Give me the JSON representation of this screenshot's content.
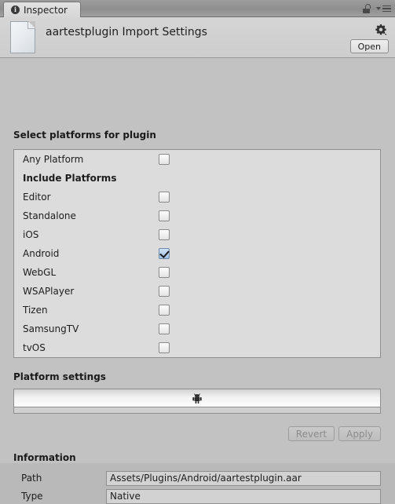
{
  "window": {
    "tab_label": "Inspector",
    "tab_icon": "info-circle-icon",
    "lock_icon": "lock-open-icon",
    "menu_icon": "hamburger-menu-icon"
  },
  "header": {
    "title": "aartestplugin Import Settings",
    "file_icon": "document-icon",
    "gear_icon": "gear-icon",
    "open_label": "Open"
  },
  "platforms": {
    "section_title": "Select platforms for plugin",
    "any_platform": {
      "label": "Any Platform",
      "checked": false
    },
    "include_title": "Include Platforms",
    "items": [
      {
        "label": "Editor",
        "checked": false
      },
      {
        "label": "Standalone",
        "checked": false
      },
      {
        "label": "iOS",
        "checked": false
      },
      {
        "label": "Android",
        "checked": true
      },
      {
        "label": "WebGL",
        "checked": false
      },
      {
        "label": "WSAPlayer",
        "checked": false
      },
      {
        "label": "Tizen",
        "checked": false
      },
      {
        "label": "SamsungTV",
        "checked": false
      },
      {
        "label": "tvOS",
        "checked": false
      }
    ]
  },
  "platform_settings": {
    "section_title": "Platform settings",
    "active_tab_icon": "android-icon"
  },
  "actions": {
    "revert_label": "Revert",
    "apply_label": "Apply",
    "revert_enabled": false,
    "apply_enabled": false
  },
  "information": {
    "section_title": "Information",
    "rows": [
      {
        "label": "Path",
        "value": "Assets/Plugins/Android/aartestplugin.aar"
      },
      {
        "label": "Type",
        "value": "Native"
      }
    ]
  },
  "colors": {
    "window_bg": "#c2c2c2",
    "panel_bg": "#dcdcdc",
    "header_bg": "#d2d2d2",
    "checkbox_checked": "#9fc0e3",
    "border": "#8f8f8f"
  }
}
